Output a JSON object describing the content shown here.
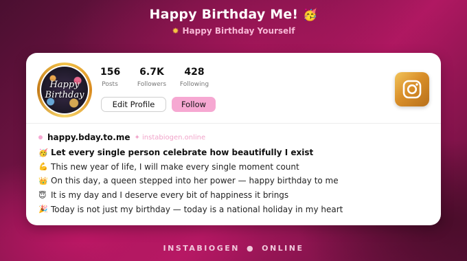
{
  "header": {
    "title": "Happy Birthday Me!",
    "title_emoji": "🥳",
    "subtitle_icon": "sun-icon",
    "subtitle": "Happy Birthday Yourself"
  },
  "profile": {
    "avatar_text_line1": "Happy",
    "avatar_text_line2": "Birthday",
    "stats": [
      {
        "value": "156",
        "label": "Posts"
      },
      {
        "value": "6.7K",
        "label": "Followers"
      },
      {
        "value": "428",
        "label": "Following"
      }
    ],
    "edit_button": "Edit Profile",
    "follow_button": "Follow",
    "instagram_icon": "instagram-icon"
  },
  "bio": {
    "handle": "happy.bday.to.me",
    "site": "✦ instabiogen.online",
    "lines": [
      {
        "emoji": "🥳",
        "text": "Let every single person celebrate how beautifully I exist"
      },
      {
        "emoji": "💪",
        "text": "This new year of life, I will make every single moment count"
      },
      {
        "emoji": "👑",
        "text": "On this day, a queen stepped into her power — happy birthday to me"
      },
      {
        "emoji": "😇",
        "text": "It is my day and I deserve every bit of happiness it brings"
      },
      {
        "emoji": "🎉",
        "text": "Today is not just my birthday — today is a national holiday in my heart"
      }
    ]
  },
  "footer": {
    "left": "INSTABIOGEN",
    "separator": "●",
    "right": "ONLINE"
  },
  "colors": {
    "accent_pink": "#f6a8d2",
    "gold": "#d98f2a",
    "background": "#8a1550"
  }
}
